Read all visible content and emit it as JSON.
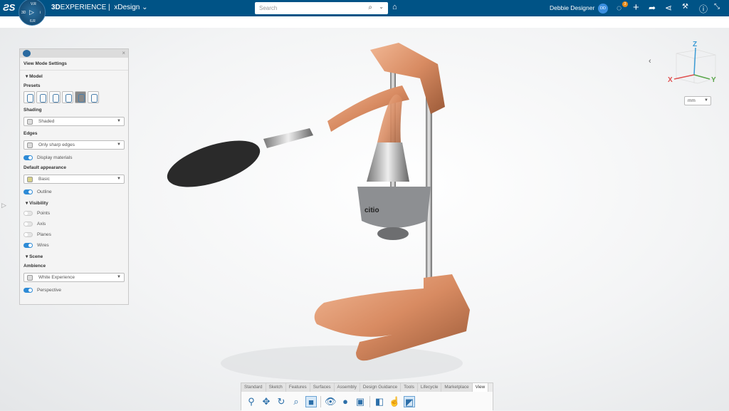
{
  "topbar": {
    "brand": "3D",
    "brand_rest": "EXPERIENCE",
    "separator": "|",
    "app": "xDesign",
    "compass": {
      "top": "V.R",
      "left": "3D",
      "right": "i",
      "bottom": "6.R"
    },
    "search_placeholder": "Search",
    "user_name": "Debbie Designer",
    "user_initials": "DD",
    "notification_count": "3"
  },
  "panel": {
    "title": "View Mode Settings",
    "model": {
      "header": "Model",
      "presets_label": "Presets",
      "shading_label": "Shading",
      "shading_value": "Shaded",
      "edges_label": "Edges",
      "edges_value": "Only sharp edges",
      "display_materials": "Display materials",
      "default_appearance_label": "Default appearance",
      "appearance_value": "Basic",
      "outline": "Outline"
    },
    "visibility": {
      "header": "Visibility",
      "points": "Points",
      "axis": "Axis",
      "planes": "Planes",
      "wires": "Wires"
    },
    "scene": {
      "header": "Scene",
      "ambience_label": "Ambience",
      "ambience_value": "White Experience",
      "perspective": "Perspective"
    }
  },
  "toggles": {
    "display_materials": true,
    "outline": true,
    "points": false,
    "axis": false,
    "planes": false,
    "wires": true,
    "perspective": true
  },
  "axes": {
    "x": "X",
    "y": "Y",
    "z": "Z"
  },
  "units": "mm",
  "toolbar": {
    "tabs": [
      "Standard",
      "Sketch",
      "Features",
      "Surfaces",
      "Assembly",
      "Design Guidance",
      "Tools",
      "Lifecycle",
      "Marketplace",
      "View"
    ],
    "active_tab": "View"
  },
  "model_label": "citio",
  "colors": {
    "header": "#005386",
    "accent": "#2e8bd6",
    "copper": "#d88b62"
  }
}
